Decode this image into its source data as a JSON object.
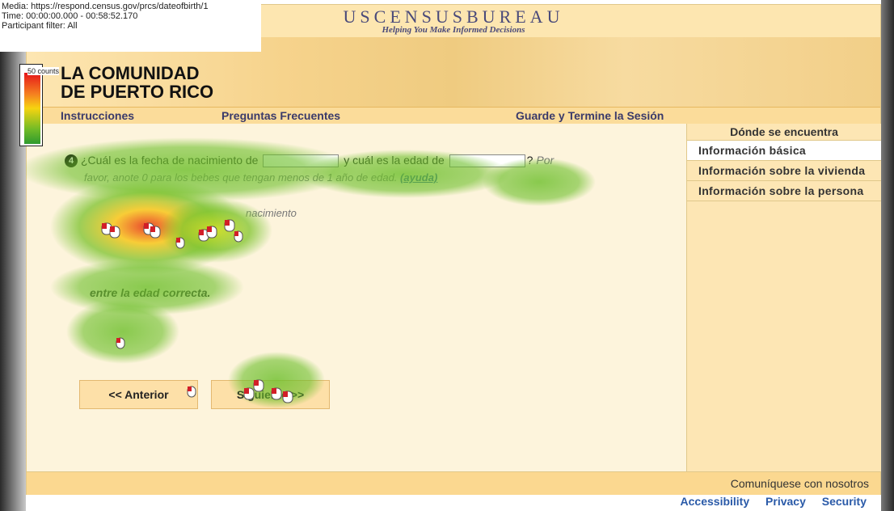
{
  "overlay": {
    "media": "Media: https://respond.census.gov/prcs/dateofbirth/1",
    "time": "Time: 00:00:00.000 - 00:58:52.170",
    "filter": "Participant filter: All",
    "legend_label": "50 counts"
  },
  "header": {
    "brand": "USCENSUSBUREAU",
    "tagline": "Helping You Make Informed Decisions",
    "banner_line1": "LA COMUNIDAD",
    "banner_line2": "DE PUERTO RICO"
  },
  "nav": {
    "items": [
      "Instrucciones",
      "Preguntas Frecuentes",
      "Guarde y Termine la Sesión"
    ]
  },
  "sidebar": {
    "heading": "Dónde se encuentra",
    "items": [
      {
        "label": "Información básica",
        "active": true
      },
      {
        "label": "Información sobre la vivienda",
        "active": false
      },
      {
        "label": "Información sobre la persona",
        "active": false
      }
    ]
  },
  "question": {
    "number": "4",
    "part1": "¿Cuál es la fecha de nacimiento de",
    "part2": "y cuál es la edad de",
    "part3": "?",
    "hint_italic": "Por",
    "sub": "favor, anote 0 para los bebes que tengan menos de 1 año de edad.",
    "help_link": "(ayuda)",
    "birth_label": "nacimiento",
    "age_note": "entre la edad correcta."
  },
  "buttons": {
    "prev": "<<  Anterior",
    "next": "Siguiente  >>"
  },
  "footer": {
    "contact": "Comuníquese con nosotros"
  },
  "bottom_links": [
    "Accessibility",
    "Privacy",
    "Security"
  ],
  "colors": {
    "brand": "#4a4a7a",
    "link": "#2a5aa8",
    "nav_bg": "#fbdc9a",
    "sidebar_bg": "#fde6b4"
  }
}
